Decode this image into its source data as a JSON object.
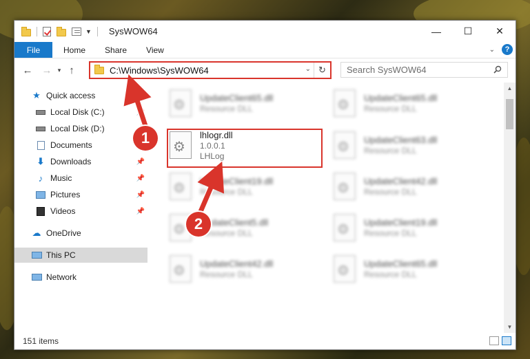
{
  "window": {
    "title": "SysWOW64",
    "controls": {
      "minimize": "—",
      "maximize": "☐",
      "close": "✕"
    }
  },
  "ribbon": {
    "tabs": [
      "File",
      "Home",
      "Share",
      "View"
    ],
    "help": "?"
  },
  "navigation": {
    "address": "C:\\Windows\\SysWOW64",
    "search_placeholder": "Search SysWOW64"
  },
  "sidebar": {
    "items": [
      {
        "label": "Quick access",
        "icon": "star-icon"
      },
      {
        "label": "Local Disk (C:)",
        "icon": "drive-icon"
      },
      {
        "label": "Local Disk (D:)",
        "icon": "drive-icon"
      },
      {
        "label": "Documents",
        "icon": "documents-icon"
      },
      {
        "label": "Downloads",
        "icon": "download-icon"
      },
      {
        "label": "Music",
        "icon": "music-icon"
      },
      {
        "label": "Pictures",
        "icon": "pictures-icon"
      },
      {
        "label": "Videos",
        "icon": "videos-icon"
      },
      {
        "label": "OneDrive",
        "icon": "cloud-icon"
      },
      {
        "label": "This PC",
        "icon": "computer-icon"
      },
      {
        "label": "Network",
        "icon": "network-icon"
      }
    ]
  },
  "files": {
    "highlighted": {
      "name": "lhlogr.dll",
      "version": "1.0.0.1",
      "company": "LHLog"
    },
    "left_column": [
      {
        "name": "UpdateClient65.dll",
        "type": "Resource DLL"
      },
      {
        "name": "UpdateClient19.dll",
        "type": "Resource DLL"
      },
      {
        "name": "UpdateClient5.dll",
        "type": "Resource DLL"
      },
      {
        "name": "UpdateClient42.dll",
        "type": "Resource DLL"
      }
    ],
    "right_column": [
      {
        "name": "UpdateClient65.dll",
        "type": "Resource DLL"
      },
      {
        "name": "UpdateClient63.dll",
        "type": "Resource DLL"
      },
      {
        "name": "UpdateClient42.dll",
        "type": "Resource DLL"
      },
      {
        "name": "UpdateClient19.dll",
        "type": "Resource DLL"
      },
      {
        "name": "UpdateClient65.dll",
        "type": "Resource DLL"
      }
    ]
  },
  "status": {
    "item_count": "151 items"
  },
  "annotations": {
    "step1": "1",
    "step2": "2"
  },
  "colors": {
    "accent": "#1979ca",
    "highlight": "#d9342b"
  }
}
